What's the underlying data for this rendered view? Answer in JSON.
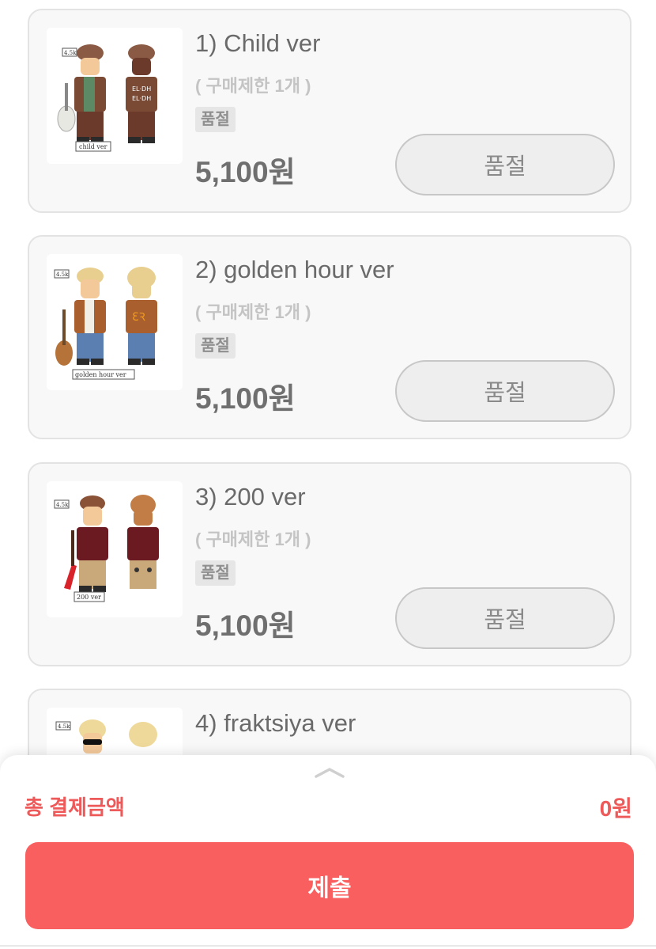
{
  "products": [
    {
      "title": "1) Child ver",
      "limit": "( 구매제한 1개 )",
      "badge": "품절",
      "price": "5,100원",
      "button": "품절",
      "thumb": {
        "tag": "4.5k",
        "caption": "child ver"
      }
    },
    {
      "title": "2) golden hour ver",
      "limit": "( 구매제한 1개 )",
      "badge": "품절",
      "price": "5,100원",
      "button": "품절",
      "thumb": {
        "tag": "4.5k",
        "caption": "golden hour ver"
      }
    },
    {
      "title": "3) 200 ver",
      "limit": "( 구매제한 1개 )",
      "badge": "품절",
      "price": "5,100원",
      "button": "품절",
      "thumb": {
        "tag": "4.5k",
        "caption": "200 ver"
      }
    },
    {
      "title": "4) fraktsiya ver",
      "thumb": {
        "tag": "4.5k"
      }
    }
  ],
  "footer": {
    "total_label": "총 결제금액",
    "total_value": "0원",
    "submit_label": "제출"
  },
  "colors": {
    "accent": "#fa5f5f",
    "accent_text": "#ee5a5a",
    "card_bg": "#f8f8f8",
    "card_border": "#e3e3e3"
  },
  "icons": {
    "sheet_handle": "chevron-up-icon"
  }
}
